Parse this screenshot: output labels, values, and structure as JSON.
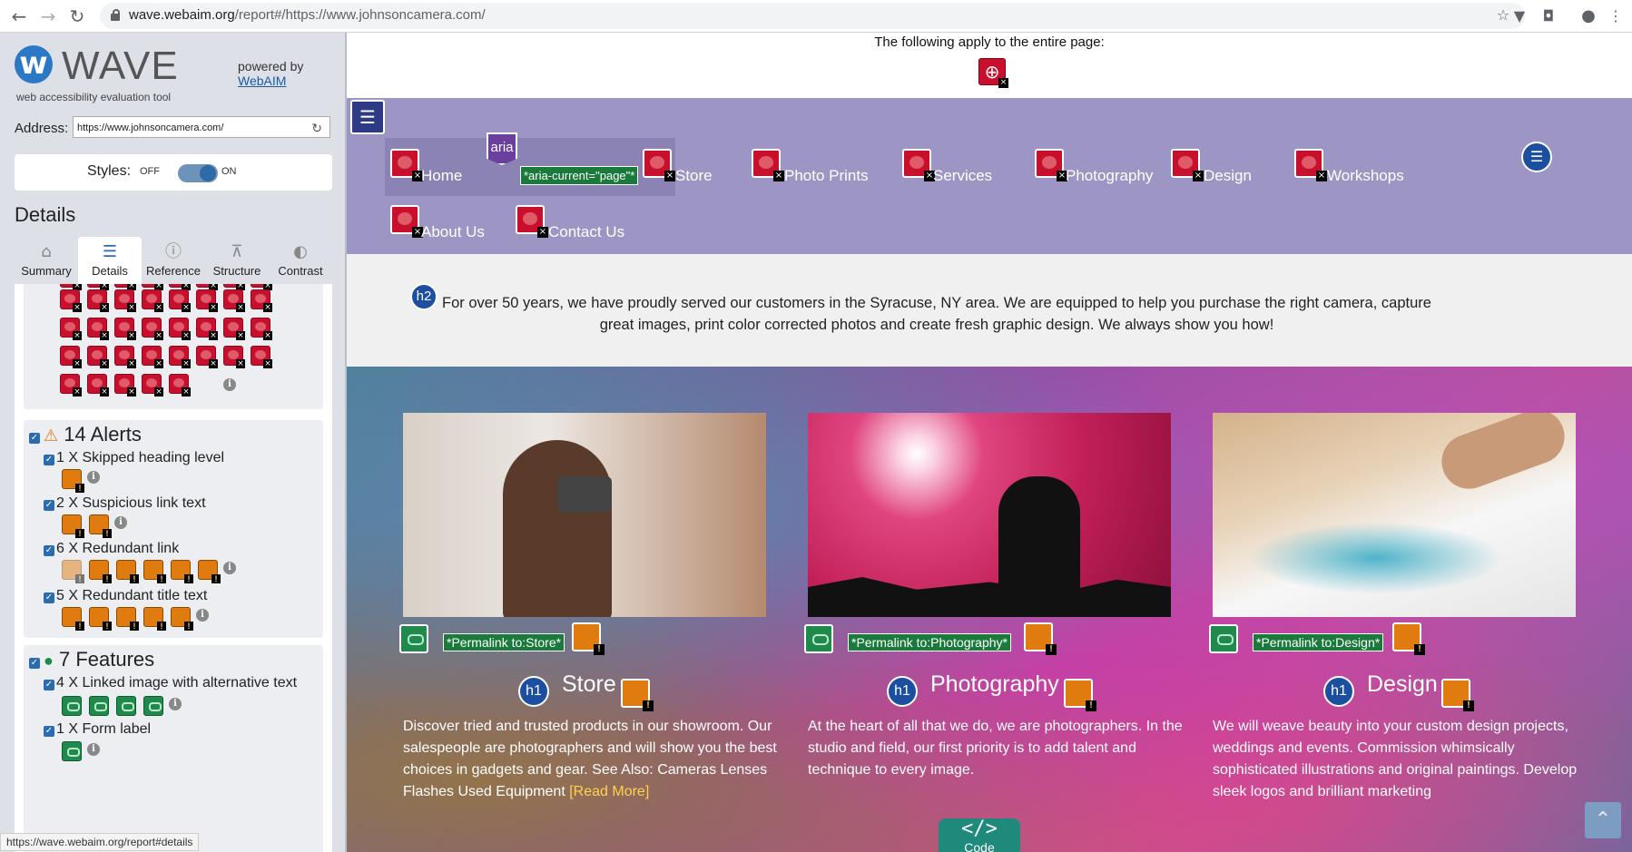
{
  "browser": {
    "url_host": "wave.webaim.org",
    "url_path": "/report#/https://www.johnsoncamera.com/",
    "status_url": "https://wave.webaim.org/report#details"
  },
  "wave": {
    "logo_text": "WAVE",
    "logo_subtitle": "web accessibility evaluation tool",
    "powered_by": "powered by",
    "webaim_link": "WebAIM",
    "address_label": "Address:",
    "address_value": "https://www.johnsoncamera.com/",
    "styles_label": "Styles:",
    "styles_off": "OFF",
    "styles_on": "ON",
    "details_heading": "Details",
    "tabs": [
      "Summary",
      "Details",
      "Reference",
      "Structure",
      "Contrast"
    ],
    "alerts": {
      "title": "14 Alerts",
      "items": [
        {
          "label": "1 X Skipped heading level",
          "count": 1
        },
        {
          "label": "2 X Suspicious link text",
          "count": 2
        },
        {
          "label": "6 X Redundant link",
          "count": 6
        },
        {
          "label": "5 X Redundant title text",
          "count": 5
        }
      ]
    },
    "features": {
      "title": "7 Features",
      "items": [
        {
          "label": "4 X Linked image with alternative text",
          "count": 4
        },
        {
          "label": "1 X Form label",
          "count": 1
        }
      ]
    }
  },
  "page": {
    "apply_text": "The following apply to the entire page:",
    "nav": [
      "Home",
      "Store",
      "Photo Prints",
      "Services",
      "Photography",
      "Design",
      "Workshops",
      "About Us",
      "Contact Us"
    ],
    "aria_label": "aria",
    "aria_current": "*aria-current=\"page\"*",
    "h2_label": "h2",
    "h1_label": "h1",
    "intro": "For over 50 years, we have proudly served our customers in the Syracuse, NY area. We are equipped to help you purchase the right camera, capture great images, print color corrected photos and create fresh graphic design. We always show you how!",
    "cards": [
      {
        "title": "Store",
        "permalink": "*Permalink to:Store*",
        "text": "Discover tried and trusted products in our showroom. Our salespeople are photographers and will show you the best choices in gadgets and gear. See Also: Cameras Lenses Flashes Used Equipment",
        "read_more": "[Read More]"
      },
      {
        "title": "Photography",
        "permalink": "*Permalink to:Photography*",
        "text": "At the heart of all that we do, we are photographers. In the studio and field, our first priority is to add talent and technique to every image.",
        "read_more": ""
      },
      {
        "title": "Design",
        "permalink": "*Permalink to:Design*",
        "text": "We will weave beauty into your custom design projects, weddings and events. Commission whimsically sophisticated illustrations and original paintings. Develop sleek logos and brilliant marketing",
        "read_more": ""
      }
    ],
    "code_symbol": "</>",
    "code_label": "Code"
  },
  "colors": {
    "nav_bg": "#9d96c4",
    "error_red": "#c8102e",
    "alert_orange": "#e07b10",
    "feature_green": "#1f8a4c",
    "structure_blue": "#1d4fa0",
    "aria_purple": "#6a3fa0"
  }
}
